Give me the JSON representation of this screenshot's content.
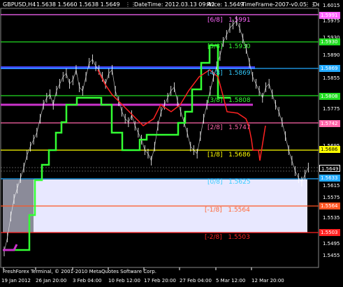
{
  "header": {
    "symbol": "GBPUSD,H4",
    "ohlc": "1.5638 1.5660 1.5638 1.5649",
    "datetime": "DateTime: 2012.03.13 09:42",
    "price": "Price: 1.5649",
    "timeframe": "TimeFrame-2007-v0.05",
    "def": "Default"
  },
  "price_axis": [
    "1.6015",
    "1.5975",
    "1.5930",
    "1.5890",
    "1.5855",
    "1.5815",
    "1.5775",
    "1.5735",
    "1.5695",
    "1.5655",
    "1.5615",
    "1.5575",
    "1.5535",
    "1.5495",
    "1.5455"
  ],
  "time_axis": [
    "19 Jan 2012",
    "26 Jan 20:00",
    "3 Feb 04:00",
    "10 Feb 12:00",
    "17 Feb 20:00",
    "27 Feb 04:00",
    "5 Mar 12:00",
    "12 Mar 20:00"
  ],
  "levels": [
    {
      "label": "[6/8]",
      "value": "1.5991",
      "color": "#ff55ff",
      "tag": "1.5991"
    },
    {
      "label": "[5/8]",
      "value": "1.5930",
      "color": "#33ff33",
      "tag": "1.5930"
    },
    {
      "label": "[4/8]",
      "value": "1.5869",
      "color": "#33ccff",
      "tag": "1.5869"
    },
    {
      "label": "[3/8]",
      "value": "1.5808",
      "color": "#33ff33",
      "tag": "1.5808"
    },
    {
      "label": "[2/8]",
      "value": "1.5747",
      "color": "#ff55aa",
      "tag": "1.5742"
    },
    {
      "label": "[1/8]",
      "value": "1.5686",
      "color": "#ffff00",
      "tag": "1.5686"
    },
    {
      "label": "[0/8]",
      "value": "1.5625",
      "color": "#33ccff",
      "tag": "1.5633"
    },
    {
      "label": "[-1/8]",
      "value": "1.5564",
      "color": "#ff5522",
      "tag": "1.5564"
    },
    {
      "label": "[-2/8]",
      "value": "1.5503",
      "color": "#ff2222",
      "tag": "1.5503"
    }
  ],
  "current_price": "1.5649",
  "footer": "FreshForex Terminal, © 2001-2010 MetaQuotes Software Corp."
}
